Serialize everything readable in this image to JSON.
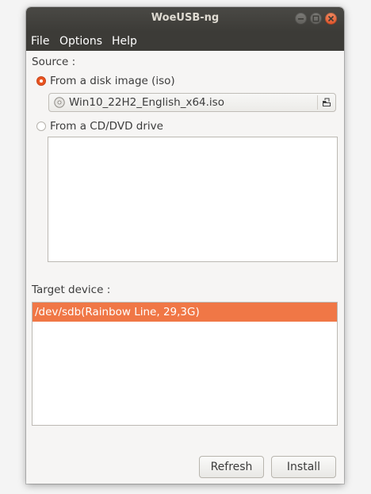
{
  "window": {
    "title": "WoeUSB-ng"
  },
  "menu": {
    "items": [
      "File",
      "Options",
      "Help"
    ]
  },
  "source": {
    "label": "Source :",
    "option_iso": "From a disk image (iso)",
    "option_iso_selected": true,
    "iso_file": "Win10_22H2_English_x64.iso",
    "option_dvd": "From a CD/DVD drive",
    "option_dvd_selected": false
  },
  "target": {
    "label": "Target device :",
    "devices": [
      "/dev/sdb(Rainbow Line, 29,3G)"
    ],
    "selected_index": 0
  },
  "buttons": {
    "refresh": "Refresh",
    "install": "Install"
  },
  "icons": {
    "disc": "optical-disc-icon",
    "open": "document-open-icon",
    "minimize": "minimize-icon",
    "maximize": "maximize-icon",
    "close": "close-icon"
  },
  "colors": {
    "accent": "#e95420",
    "selection": "#f07746",
    "titlebar": "#3c3b37"
  }
}
